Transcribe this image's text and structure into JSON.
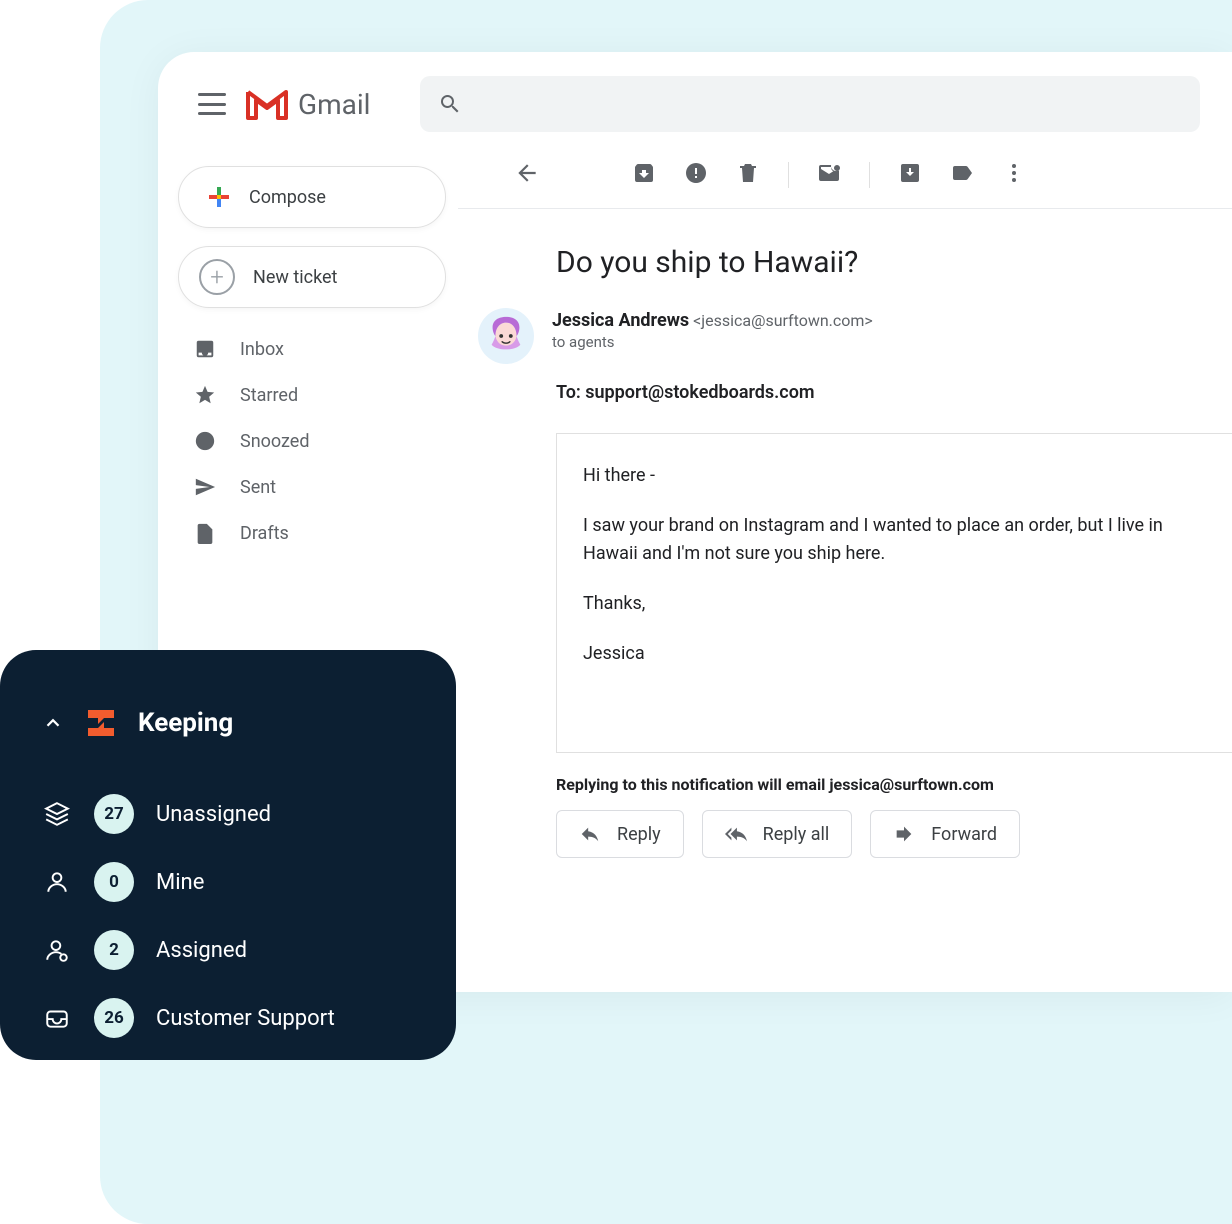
{
  "app": {
    "name": "Gmail"
  },
  "header": {
    "compose": "Compose",
    "new_ticket": "New ticket"
  },
  "sidebar": {
    "items": [
      {
        "label": "Inbox"
      },
      {
        "label": "Starred"
      },
      {
        "label": "Snoozed"
      },
      {
        "label": "Sent"
      },
      {
        "label": "Drafts"
      }
    ]
  },
  "email": {
    "subject": "Do you ship to Hawaii?",
    "sender_name": "Jessica Andrews",
    "sender_email": "<jessica@surftown.com>",
    "sender_to": "to agents",
    "to_label": "To: support@stokedboards.com",
    "body": {
      "greeting": "Hi there -",
      "p1": "I saw your brand on Instagram and I wanted to place an order, but I live in Hawaii and I'm not sure you ship here.",
      "thanks": "Thanks,",
      "sign": "Jessica"
    },
    "reply_note": "Replying to this notification will email jessica@surftown.com",
    "actions": {
      "reply": "Reply",
      "reply_all": "Reply all",
      "forward": "Forward"
    }
  },
  "keeping": {
    "title": "Keeping",
    "items": [
      {
        "count": "27",
        "label": "Unassigned"
      },
      {
        "count": "0",
        "label": "Mine"
      },
      {
        "count": "2",
        "label": "Assigned"
      },
      {
        "count": "26",
        "label": "Customer Support"
      }
    ]
  }
}
